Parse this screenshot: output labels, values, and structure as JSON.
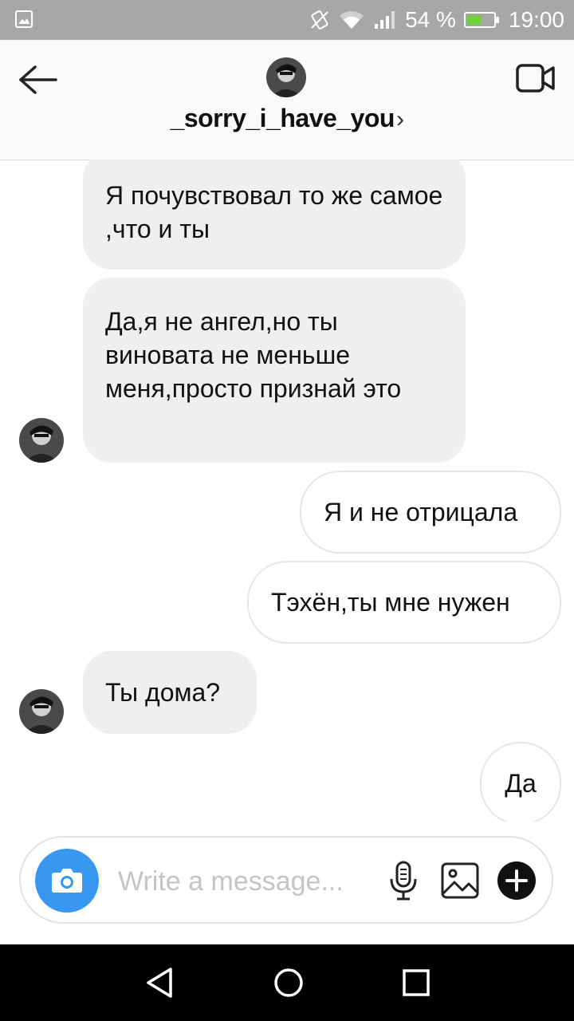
{
  "status_bar": {
    "battery_text": "54 %",
    "battery_level": 0.54,
    "time": "19:00",
    "icons": [
      "image-icon",
      "vibrate-icon",
      "wifi-icon",
      "signal-icon",
      "battery-icon"
    ]
  },
  "header": {
    "username": "_sorry_i_have_you",
    "chevron": "›",
    "icons": [
      "back-arrow-icon",
      "video-call-icon"
    ]
  },
  "messages": [
    {
      "direction": "incoming",
      "text": "Я почувствовал то же самое ,что и ты"
    },
    {
      "direction": "incoming",
      "text": "Да,я не ангел,но ты виновата не меньше меня,просто признай это"
    },
    {
      "direction": "outgoing",
      "text": "Я и не отрицала"
    },
    {
      "direction": "outgoing",
      "text": "Тэхён,ты мне нужен"
    },
    {
      "direction": "incoming",
      "text": "Ты дома?"
    },
    {
      "direction": "outgoing",
      "text": "Да"
    }
  ],
  "composer": {
    "placeholder": "Write a message...",
    "value": "",
    "icons": [
      "camera-icon",
      "microphone-icon",
      "gallery-icon",
      "plus-icon"
    ]
  },
  "nav_bar": {
    "icons": [
      "back-triangle-icon",
      "home-circle-icon",
      "recents-square-icon"
    ]
  },
  "colors": {
    "accent": "#3897f0",
    "incoming_bubble": "#efefef",
    "outgoing_border": "#e6e6e6",
    "status_bar": "#a7a7a7",
    "battery_fill": "#6fcf3a"
  }
}
